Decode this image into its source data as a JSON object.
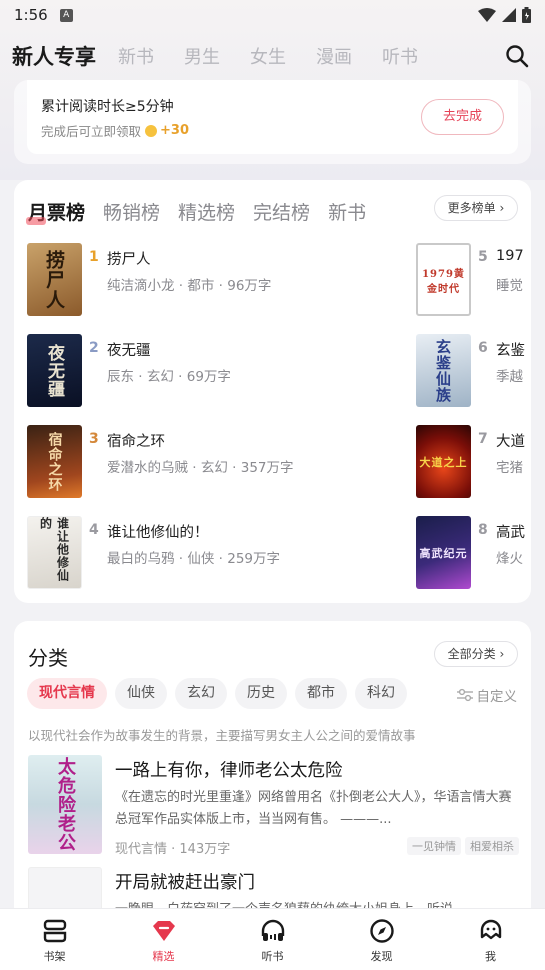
{
  "status": {
    "time": "1:56",
    "app_badge": "A"
  },
  "top_tabs": [
    "新人专享",
    "新书",
    "男生",
    "女生",
    "漫画",
    "听书"
  ],
  "task": {
    "title": "累计阅读时长≥5分钟",
    "subtitle": "完成后可立即领取",
    "reward": "+30",
    "button": "去完成"
  },
  "ranking": {
    "tabs": [
      "月票榜",
      "畅销榜",
      "精选榜",
      "完结榜",
      "新书"
    ],
    "more": "更多榜单",
    "items": [
      {
        "rank": "1",
        "name": "捞尸人",
        "meta": "纯洁滴小龙 · 都市 · 96万字",
        "cover_text": "捞尸人"
      },
      {
        "rank": "2",
        "name": "夜无疆",
        "meta": "辰东 · 玄幻 · 69万字",
        "cover_text": "夜无疆"
      },
      {
        "rank": "3",
        "name": "宿命之环",
        "meta": "爱潜水的乌贼 · 玄幻 · 357万字",
        "cover_text": "宿命之环"
      },
      {
        "rank": "4",
        "name": "谁让他修仙的！",
        "meta": "最白的乌鸦 · 仙侠 · 259万字",
        "cover_text": "谁让他修仙的"
      },
      {
        "rank": "5",
        "name": "197",
        "meta": "睡觉",
        "cover_text": "1979黄金时代"
      },
      {
        "rank": "6",
        "name": "玄鉴",
        "meta": "季越",
        "cover_text": "玄鉴仙族"
      },
      {
        "rank": "7",
        "name": "大道",
        "meta": "宅猪",
        "cover_text": "大道之上"
      },
      {
        "rank": "8",
        "name": "高武",
        "meta": "烽火",
        "cover_text": "高武纪元"
      }
    ]
  },
  "category": {
    "title": "分类",
    "all": "全部分类",
    "chips": [
      "现代言情",
      "仙侠",
      "玄幻",
      "历史",
      "都市",
      "科幻"
    ],
    "custom": "自定义",
    "description": "以现代社会作为故事发生的背景，主要描写男女主人公之间的爱情故事",
    "books": [
      {
        "title": "一路上有你，律师老公太危险",
        "intro": "《在遗忘的时光里重逢》网络曾用名《扑倒老公大人》，华语言情大赛总冠军作品实体版上市，当当网有售。 ———...",
        "meta": "现代言情 · 143万字",
        "tags": [
          "一见钟情",
          "相爱相杀"
        ],
        "cover_text": "太危险老公"
      },
      {
        "title": "开局就被赶出豪门",
        "intro": "一睁眼，白莜穿到了一个声名狼藉的纨绔大小姐身上。听说...",
        "meta": "",
        "tags": [],
        "cover_text": ""
      }
    ]
  },
  "nav": [
    {
      "label": "书架",
      "icon": "bookshelf-icon"
    },
    {
      "label": "精选",
      "icon": "featured-icon"
    },
    {
      "label": "听书",
      "icon": "headphones-icon"
    },
    {
      "label": "发现",
      "icon": "compass-icon"
    },
    {
      "label": "我",
      "icon": "profile-icon"
    }
  ],
  "colors": {
    "accent": "#e5384d",
    "accent_light": "#fde8ea",
    "gold": "#e8a12b",
    "rank_blue": "#8a9bc4"
  }
}
